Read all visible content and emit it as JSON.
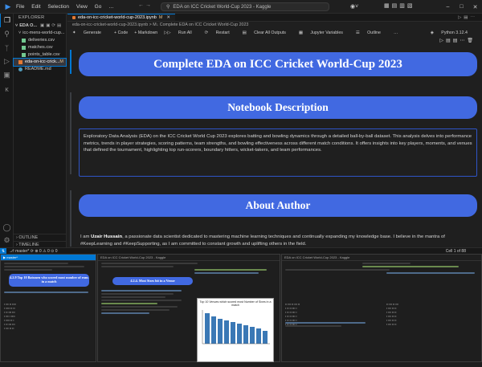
{
  "titlebar": {
    "menu": [
      "File",
      "Edit",
      "Selection",
      "View",
      "Go",
      "…"
    ],
    "window_title": "EDA on ICC Cricket World-Cup 2023 - Kaggle",
    "window_buttons": [
      "–",
      "□",
      "✕"
    ]
  },
  "activitybar": {
    "icons": [
      "files-icon",
      "search-icon",
      "source-control-icon",
      "run-debug-icon",
      "extensions-icon",
      "kaggle-icon"
    ]
  },
  "sidebar": {
    "header": "EXPLORER",
    "project": "EDA O...",
    "items": [
      {
        "label": "icc-mens-world-cup...",
        "color": "#cccccc"
      },
      {
        "label": "deliveries.csv",
        "color": "#73c991"
      },
      {
        "label": "matches.csv",
        "color": "#73c991"
      },
      {
        "label": "points_table.csv",
        "color": "#73c991"
      },
      {
        "label": "eda-on-icc-crick...",
        "badge": "M",
        "color": "#e37933",
        "selected": true
      },
      {
        "label": "README.md",
        "color": "#519aba"
      }
    ],
    "outline": "OUTLINE",
    "timeline": "TIMELINE"
  },
  "editor": {
    "tab_label": "eda-on-icc-cricket-world-cup-2023.ipynb",
    "tab_badge": "M",
    "breadcrumb": "eda-on-icc-cricket-world-cup-2023.ipynb > M↓ Complete EDA on ICC Cricket World-Cup 2023",
    "toolbar": [
      "Generate",
      "+ Code",
      "+ Markdown",
      "Run All",
      "Restart",
      "Clear All Outputs",
      "Jupyter Variables",
      "Outline",
      "…"
    ],
    "kernel": "Python 3.12.4"
  },
  "notebook": {
    "title": "Complete EDA on ICC Cricket World-Cup 2023",
    "desc_heading": "Notebook Description",
    "description": "Exploratory Data Analysis (EDA) on the ICC Cricket World Cup 2023 explores batting and bowling dynamics through a detailed ball-by-ball dataset. This analysis delves into performance metrics, trends in player strategies, scoring patterns, team strengths, and bowling effectiveness across different match conditions. It offers insights into key players, moments, and venues that defined the tournament, highlighting top run-scorers, boundary hitters, wicket-takers, and team performances.",
    "author_heading": "About Author",
    "author_prefix": "I am ",
    "author_name": "Uzair Hussain",
    "author_text": ", a passionate data scientist dedicated to mastering machine learning techniques and continually expanding my knowledge base. I believe in the mantra of #KeepLearning and #KeepSupporting, as I am committed to constant growth and uplifting others in the field."
  },
  "statusbar": {
    "left": "⎇ master* ⟳  ⊗ 0 ⚠ 0  ⊙ 0",
    "right": "Cell 1 of 88"
  },
  "thumbnails": {
    "heading1": "4.2.9 Top 10 Batsmen who scored most number of runs in a match",
    "heading2": "4.2.4. Most Sixes hit in a Venue",
    "plot_title": "Top 10 Venues which scored most Number of Sixes in a match",
    "colors": {
      "accent": "#4169e1",
      "bars": "#3a78b5"
    }
  },
  "colors": {
    "heading_bg": "#4169e1",
    "editor_bg": "#1f1f1f",
    "desc_border": "#2f55c8"
  }
}
